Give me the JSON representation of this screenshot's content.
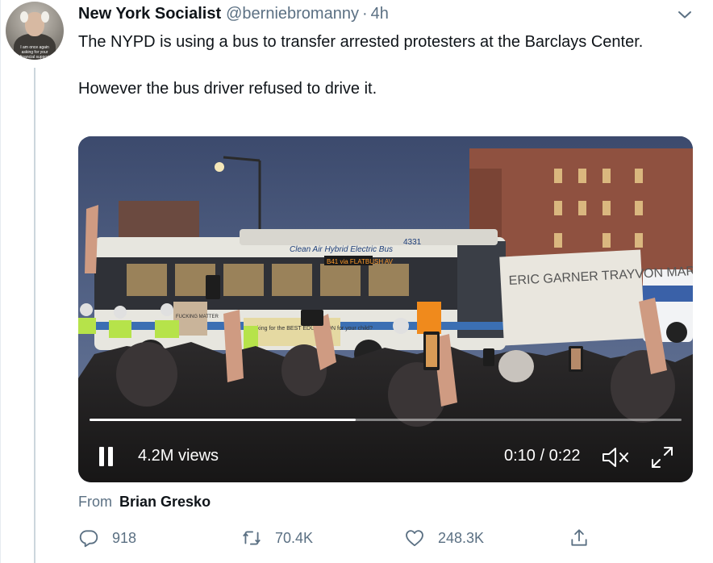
{
  "tweet": {
    "author_name": "New York Socialist",
    "author_handle": "@berniebromanny",
    "separator": "·",
    "time_ago": "4h",
    "avatar_caption": "I am once again asking for your financial support",
    "text_lines": [
      "The NYPD is using a bus to transfer arrested protesters at the Barclays Center.",
      "However the bus driver refused to drive it."
    ]
  },
  "video": {
    "views": "4.2M views",
    "timer": "0:10 / 0:22",
    "progress": 0.45,
    "scene_text": {
      "bus_banner": "Clean Air Hybrid Electric Bus",
      "bus_number": "4331",
      "route_sign": "B41 via FLATBUSH AV",
      "ad_text": "Looking for the BEST EDUCATION for your child?",
      "protest_sign": "ERIC GARNER TRAYVON MARTIN GEORGE FLOYD",
      "small_sign": "FUCKING MATTER"
    }
  },
  "attribution": {
    "label": "From",
    "author": "Brian Gresko"
  },
  "actions": {
    "reply_count": "918",
    "retweet_count": "70.4K",
    "like_count": "248.3K"
  },
  "icons": {
    "caret": "chevron-down-icon",
    "pause": "pause-icon",
    "mute": "speaker-muted-icon",
    "fullscreen": "fullscreen-icon",
    "reply": "speech-bubble-icon",
    "retweet": "retweet-arrows-icon",
    "like": "heart-icon",
    "share": "share-upload-icon"
  },
  "colors": {
    "text_primary": "#0f1419",
    "text_secondary": "#5b7083",
    "thread_line": "#ccd6dd"
  }
}
